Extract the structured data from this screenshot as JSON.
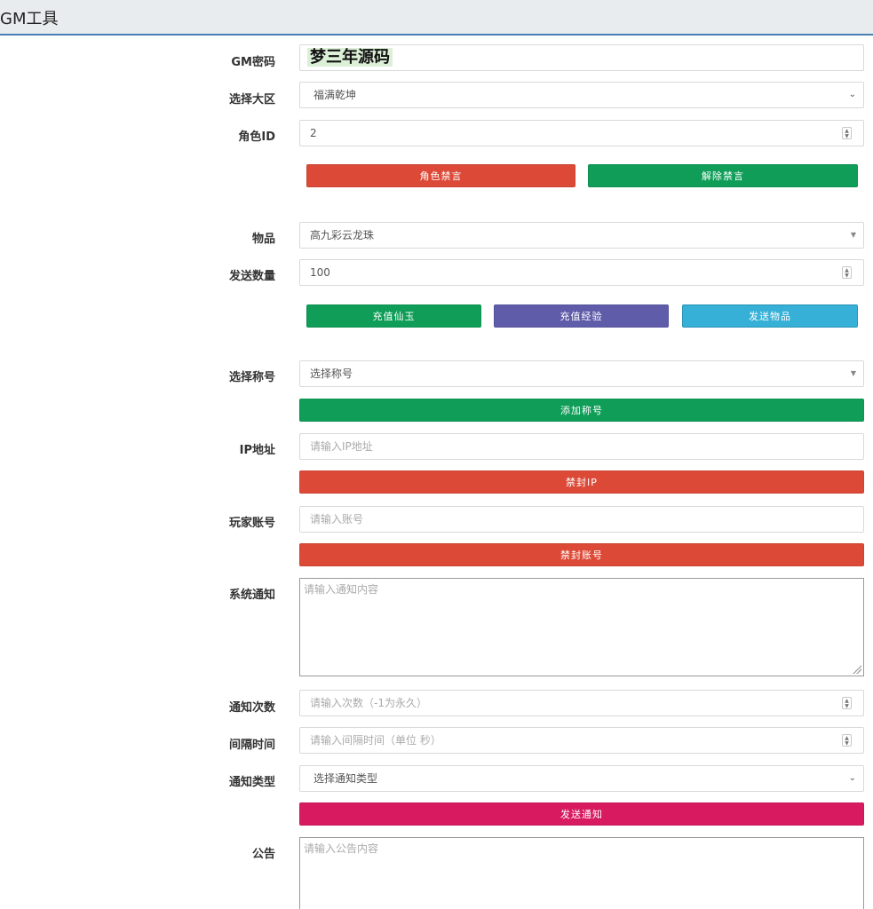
{
  "header": {
    "title": "GM工具"
  },
  "gm": {
    "label": "GM密码",
    "value": "梦三年源码"
  },
  "zone": {
    "label": "选择大区",
    "value": "福满乾坤"
  },
  "role": {
    "label": "角色ID",
    "value": "2"
  },
  "mute": {
    "mute_label": "角色禁言",
    "unmute_label": "解除禁言"
  },
  "item": {
    "label": "物品",
    "value": "高九彩云龙珠"
  },
  "quantity": {
    "label": "发送数量",
    "value": "100"
  },
  "recharge": {
    "jade_label": "充值仙玉",
    "exp_label": "充值经验",
    "send_label": "发送物品"
  },
  "title_select": {
    "label": "选择称号",
    "value": "选择称号",
    "add_label": "添加称号"
  },
  "ip": {
    "label": "IP地址",
    "placeholder": "请输入IP地址",
    "ban_label": "禁封IP"
  },
  "account": {
    "label": "玩家账号",
    "placeholder": "请输入账号",
    "ban_label": "禁封账号"
  },
  "notice": {
    "label": "系统通知",
    "placeholder": "请输入通知内容"
  },
  "notice_count": {
    "label": "通知次数",
    "placeholder": "请输入次数（-1为永久）"
  },
  "interval": {
    "label": "间隔时间",
    "placeholder": "请输入间隔时间（单位 秒）"
  },
  "notice_type": {
    "label": "通知类型",
    "value": "选择通知类型",
    "send_label": "发送通知"
  },
  "announcement": {
    "label": "公告",
    "placeholder": "请输入公告内容"
  },
  "colors": {
    "red": "#dc4a37",
    "green": "#0f9d58",
    "purple": "#5f5caa",
    "cyan": "#36b0d6",
    "crimson": "#d81b60",
    "header_border": "#4a7fb3"
  },
  "icons": {
    "select_chevron": "chevron-down-icon",
    "select_triangle": "triangle-down-icon",
    "number_spinner": "spinner-icon",
    "textarea_resize": "resize-handle-icon"
  }
}
